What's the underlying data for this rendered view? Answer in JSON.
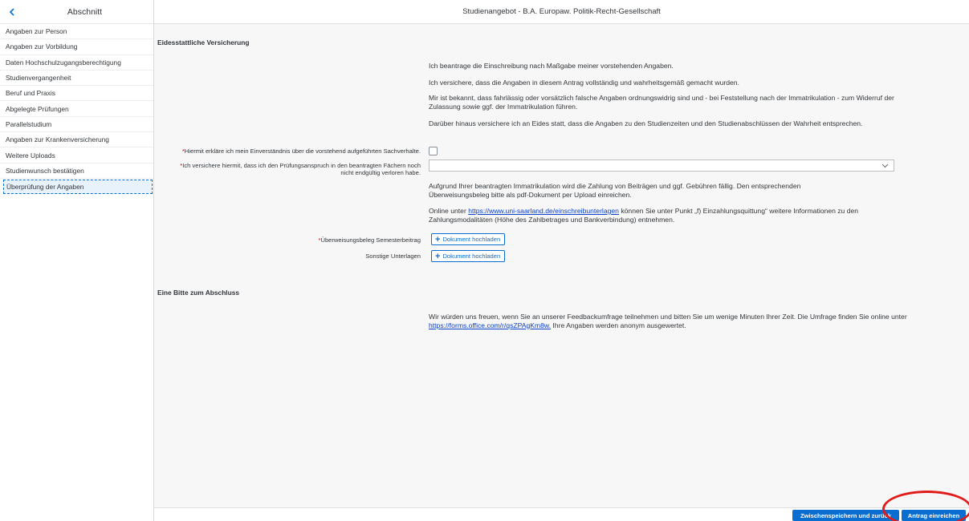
{
  "sidebar": {
    "title": "Abschnitt",
    "items": [
      {
        "label": "Angaben zur Person"
      },
      {
        "label": "Angaben zur Vorbildung"
      },
      {
        "label": "Daten Hochschulzugangsberechtigung"
      },
      {
        "label": "Studienvergangenheit"
      },
      {
        "label": "Beruf und Praxis"
      },
      {
        "label": "Abgelegte Prüfungen"
      },
      {
        "label": "Parallelstudium"
      },
      {
        "label": "Angaben zur Krankenversicherung"
      },
      {
        "label": "Weitere Uploads"
      },
      {
        "label": "Studienwunsch bestätigen"
      },
      {
        "label": "Überprüfung der Angaben",
        "active": true
      }
    ]
  },
  "header": {
    "title": "Studienangebot - B.A. Europaw. Politik-Recht-Gesellschaft"
  },
  "declaration": {
    "title": "Eidesstattliche Versicherung",
    "paragraphs": [
      "Ich beantrage die Einschreibung nach Maßgabe meiner vorstehenden Angaben.",
      "Ich versichere, dass die Angaben in diesem Antrag vollständig und wahrheitsgemäß gemacht wurden.",
      "Mir ist bekannt, dass fahrlässig oder vorsätzlich falsche Angaben ordnungswidrig sind und - bei Feststellung nach der Immatrikulation - zum Widerruf der Zulassung sowie ggf. der Immatrikulation führen.",
      "Darüber hinaus versichere ich an Eides statt, dass die Angaben zu den Studienzeiten und den Studienabschlüssen der Wahrheit entsprechen."
    ],
    "consent_label": "Hiermit erkläre ich mein Einverständnis über die vorstehend aufgeführten Sachverhalte.",
    "exam_label": "Ich versichere hiermit, dass ich den Prüfungsanspruch in den beantragten Fächern noch nicht endgültig verloren habe.",
    "exam_value": "",
    "payment_text": "Aufgrund Ihrer beantragten Immatrikulation wird die Zahlung von Beiträgen und ggf. Gebühren fällig. Den entsprechenden Überweisungsbeleg bitte als pdf-Dokument per Upload einreichen.",
    "online_prefix": "Online unter ",
    "online_link": "https://www.uni-saarland.de/einschreibunterlagen",
    "online_suffix": " können Sie unter Punkt „f) Einzahlungsquittung“ weitere Informationen zu den Zahlungsmodalitäten (Höhe des Zahlbetrages und Bankverbindung) entnehmen.",
    "upload1_label": "Überweisungsbeleg Semesterbeitrag",
    "upload2_label": "Sonstige Unterlagen",
    "upload_button": "Dokument hochladen"
  },
  "closing": {
    "title": "Eine Bitte zum Abschluss",
    "text_prefix": "Wir würden uns freuen, wenn Sie an unserer Feedbackumfrage teilnehmen und bitten Sie um wenige Minuten Ihrer Zeit. Die Umfrage finden Sie online unter ",
    "link": "https://forms.office.com/r/qsZPAgKm8w.",
    "text_suffix": " Ihre Angaben werden anonym ausgewertet."
  },
  "footer": {
    "save_label": "Zwischenspeichern und zurück",
    "submit_label": "Antrag einreichen"
  },
  "colors": {
    "accent": "#0a6ed1",
    "required": "#bb0000",
    "annotation": "#e11a1a"
  }
}
